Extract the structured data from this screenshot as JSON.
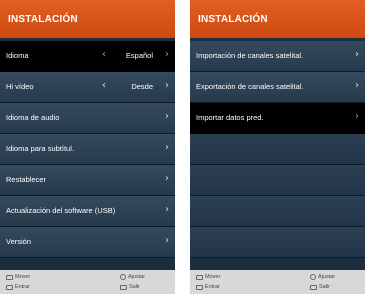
{
  "left": {
    "header": {
      "title": "INSTALACIÓN"
    },
    "items": [
      {
        "label": "Idioma",
        "value": "Español",
        "selected": true
      },
      {
        "label": "Hi vídeo",
        "value": "Desde"
      },
      {
        "label": "Idioma de audio"
      },
      {
        "label": "Idioma para subtítul."
      },
      {
        "label": "Restablecer"
      },
      {
        "label": "Actualización del software (USB)"
      },
      {
        "label": "Versión"
      }
    ],
    "footer": {
      "item1": "Mover",
      "item2": "Entrar",
      "item3": "Ajustar",
      "item4": "Salir"
    }
  },
  "right": {
    "header": {
      "title": "INSTALACIÓN"
    },
    "items": [
      {
        "label": "Importación de canales satelital."
      },
      {
        "label": "Exportación de canales satelital."
      },
      {
        "label": "Importar datos pred.",
        "selected": true
      }
    ],
    "footer": {
      "item1": "Mover",
      "item2": "Entrar",
      "item3": "Ajustar",
      "item4": "Salir"
    }
  },
  "colors": {
    "header": "#d8541a",
    "row": "#2f4457",
    "selected": "#000000",
    "accent": "#f08a1e",
    "footer": "#d6d8da"
  },
  "icons": {
    "left_arrow": "chevron-left-icon",
    "right_arrow": "chevron-right-icon"
  }
}
